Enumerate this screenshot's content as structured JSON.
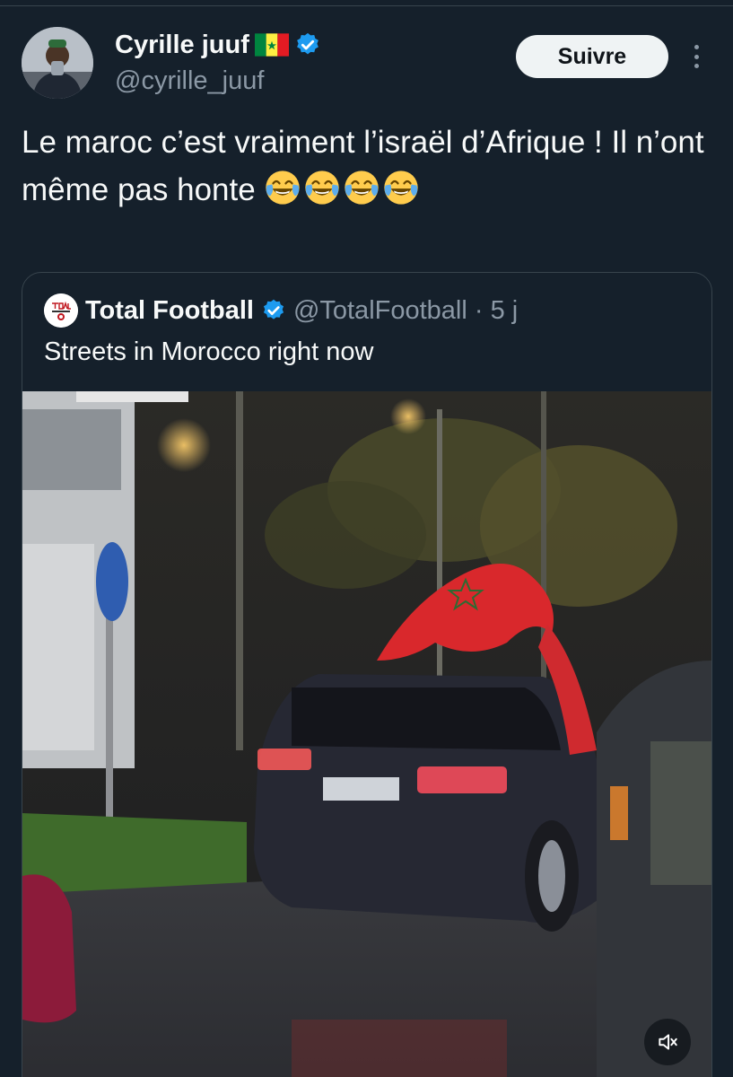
{
  "author": {
    "display_name": "Cyrille juuf",
    "handle": "@cyrille_juuf",
    "avatar_icon": "avatar-photo",
    "flag_icon": "senegal-flag",
    "verified_icon": "verified-badge-icon"
  },
  "actions": {
    "follow_label": "Suivre",
    "more_icon": "more-vertical-icon"
  },
  "tweet": {
    "text": "Le maroc c’est vraiment l’israël d’Afrique ! Il n’ont même pas honte",
    "emoji": "face-with-tears-of-joy",
    "emoji_count": 4
  },
  "quote": {
    "display_name": "Total Football",
    "handle_time": "@TotalFootball · 5 j",
    "text": "Streets in Morocco right now",
    "avatar_icon": "total-football-logo",
    "media": {
      "type": "video",
      "mute_icon": "volume-muted-icon"
    }
  },
  "colors": {
    "background": "#15202b",
    "verified": "#1d9bf0",
    "secondary_text": "#8b98a5",
    "follow_button": "#eff3f4"
  }
}
